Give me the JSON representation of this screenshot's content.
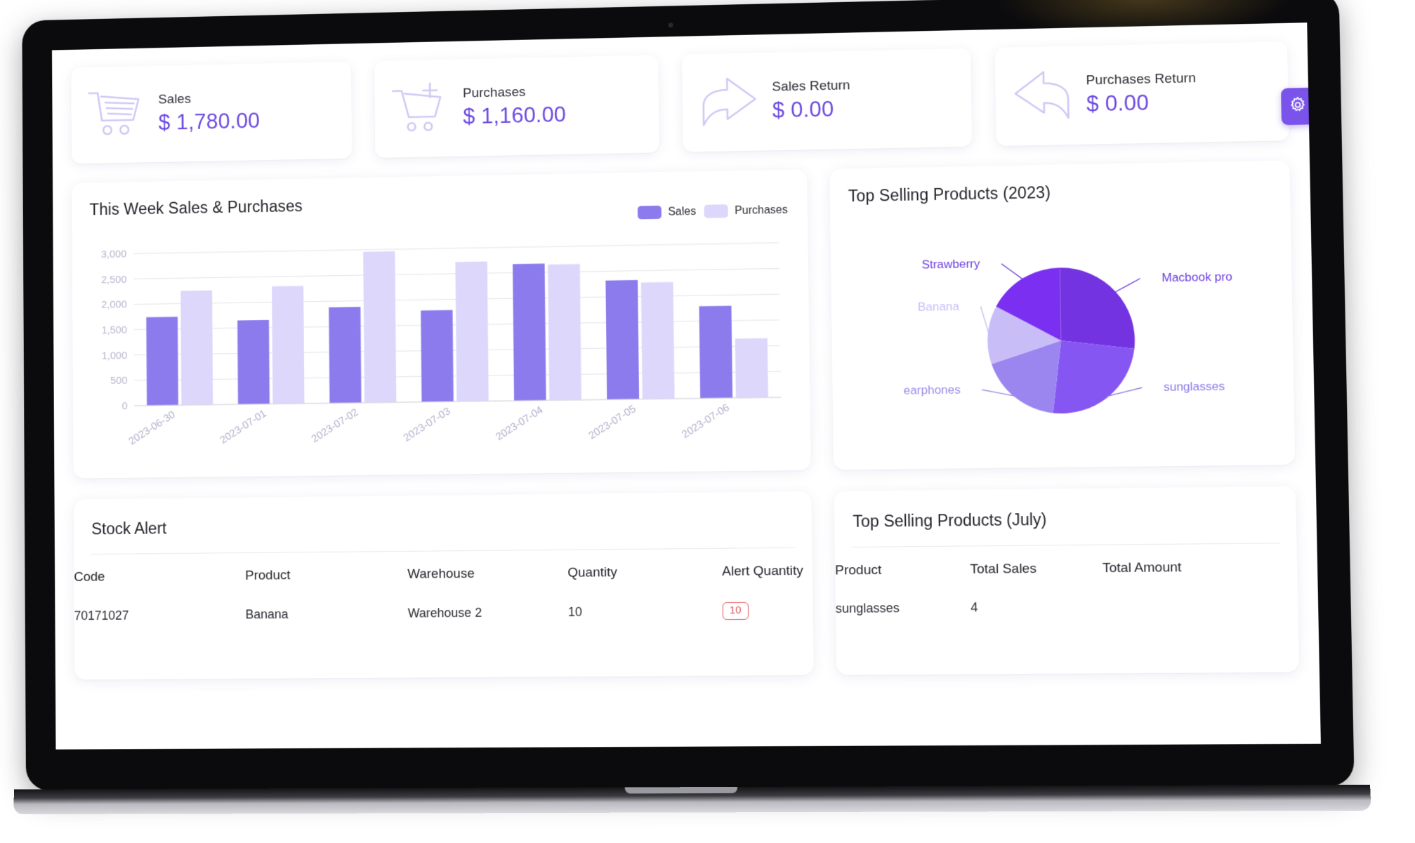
{
  "stats": [
    {
      "label": "Sales",
      "value": "$ 1,780.00",
      "icon": "shopping-cart-icon"
    },
    {
      "label": "Purchases",
      "value": "$ 1,160.00",
      "icon": "cart-plus-icon"
    },
    {
      "label": "Sales Return",
      "value": "$ 0.00",
      "icon": "arrow-forward-icon"
    },
    {
      "label": "Purchases Return",
      "value": "$ 0.00",
      "icon": "arrow-back-icon"
    }
  ],
  "settings_button": {
    "icon": "gear-icon",
    "label": ""
  },
  "bar_panel": {
    "title": "This Week Sales & Purchases",
    "legend": [
      {
        "label": "Sales",
        "color": "#8b7bec"
      },
      {
        "label": "Purchases",
        "color": "#dcd7fb"
      }
    ]
  },
  "pie_panel": {
    "title": "Top Selling Products (2023)"
  },
  "stock_alert": {
    "title": "Stock Alert",
    "columns": [
      "Code",
      "Product",
      "Warehouse",
      "Quantity",
      "Alert Quantity"
    ],
    "rows": [
      {
        "code": "70171027",
        "product": "Banana",
        "warehouse": "Warehouse 2",
        "quantity": "10",
        "alert_quantity": "10"
      }
    ]
  },
  "top_selling_july": {
    "title": "Top Selling Products (July)",
    "columns": [
      "Product",
      "Total Sales",
      "Total Amount"
    ],
    "rows": [
      {
        "product": "sunglasses",
        "total_sales": "4",
        "total_amount": ""
      }
    ]
  },
  "chart_data": [
    {
      "type": "bar",
      "title": "This Week Sales & Purchases",
      "categories": [
        "2023-06-30",
        "2023-07-01",
        "2023-07-02",
        "2023-07-03",
        "2023-07-04",
        "2023-07-05",
        "2023-07-06"
      ],
      "series": [
        {
          "name": "Sales",
          "color": "#8b7bec",
          "values": [
            1740,
            1650,
            1880,
            1790,
            2670,
            2320,
            1790
          ]
        },
        {
          "name": "Purchases",
          "color": "#dcd7fb",
          "values": [
            2250,
            2310,
            2960,
            2730,
            2650,
            2270,
            1150
          ]
        }
      ],
      "xlabel": "",
      "ylabel": "",
      "ylim": [
        0,
        3000
      ],
      "yticks": [
        0,
        500,
        1000,
        1500,
        2000,
        2500,
        3000
      ],
      "ytick_labels": [
        "0",
        "500",
        "1,000",
        "1,500",
        "2,000",
        "2,500",
        "3,000"
      ],
      "grid": true,
      "legend_position": "top-right"
    },
    {
      "type": "pie",
      "title": "Top Selling Products (2023)",
      "labels": [
        "Macbook pro",
        "sunglasses",
        "earphones",
        "Banana",
        "Strawberry"
      ],
      "values": [
        27,
        25,
        18,
        13,
        17
      ],
      "colors": [
        "#7333e0",
        "#8656f2",
        "#9b86f0",
        "#c8bdf7",
        "#7b2ff0"
      ],
      "label_colors": [
        "#6c3ce0",
        "#8b79e6",
        "#9d8ce8",
        "#c9bef7",
        "#6c3ce0"
      ],
      "start_angle_deg": -90,
      "legend_position": "callout-labels"
    }
  ]
}
